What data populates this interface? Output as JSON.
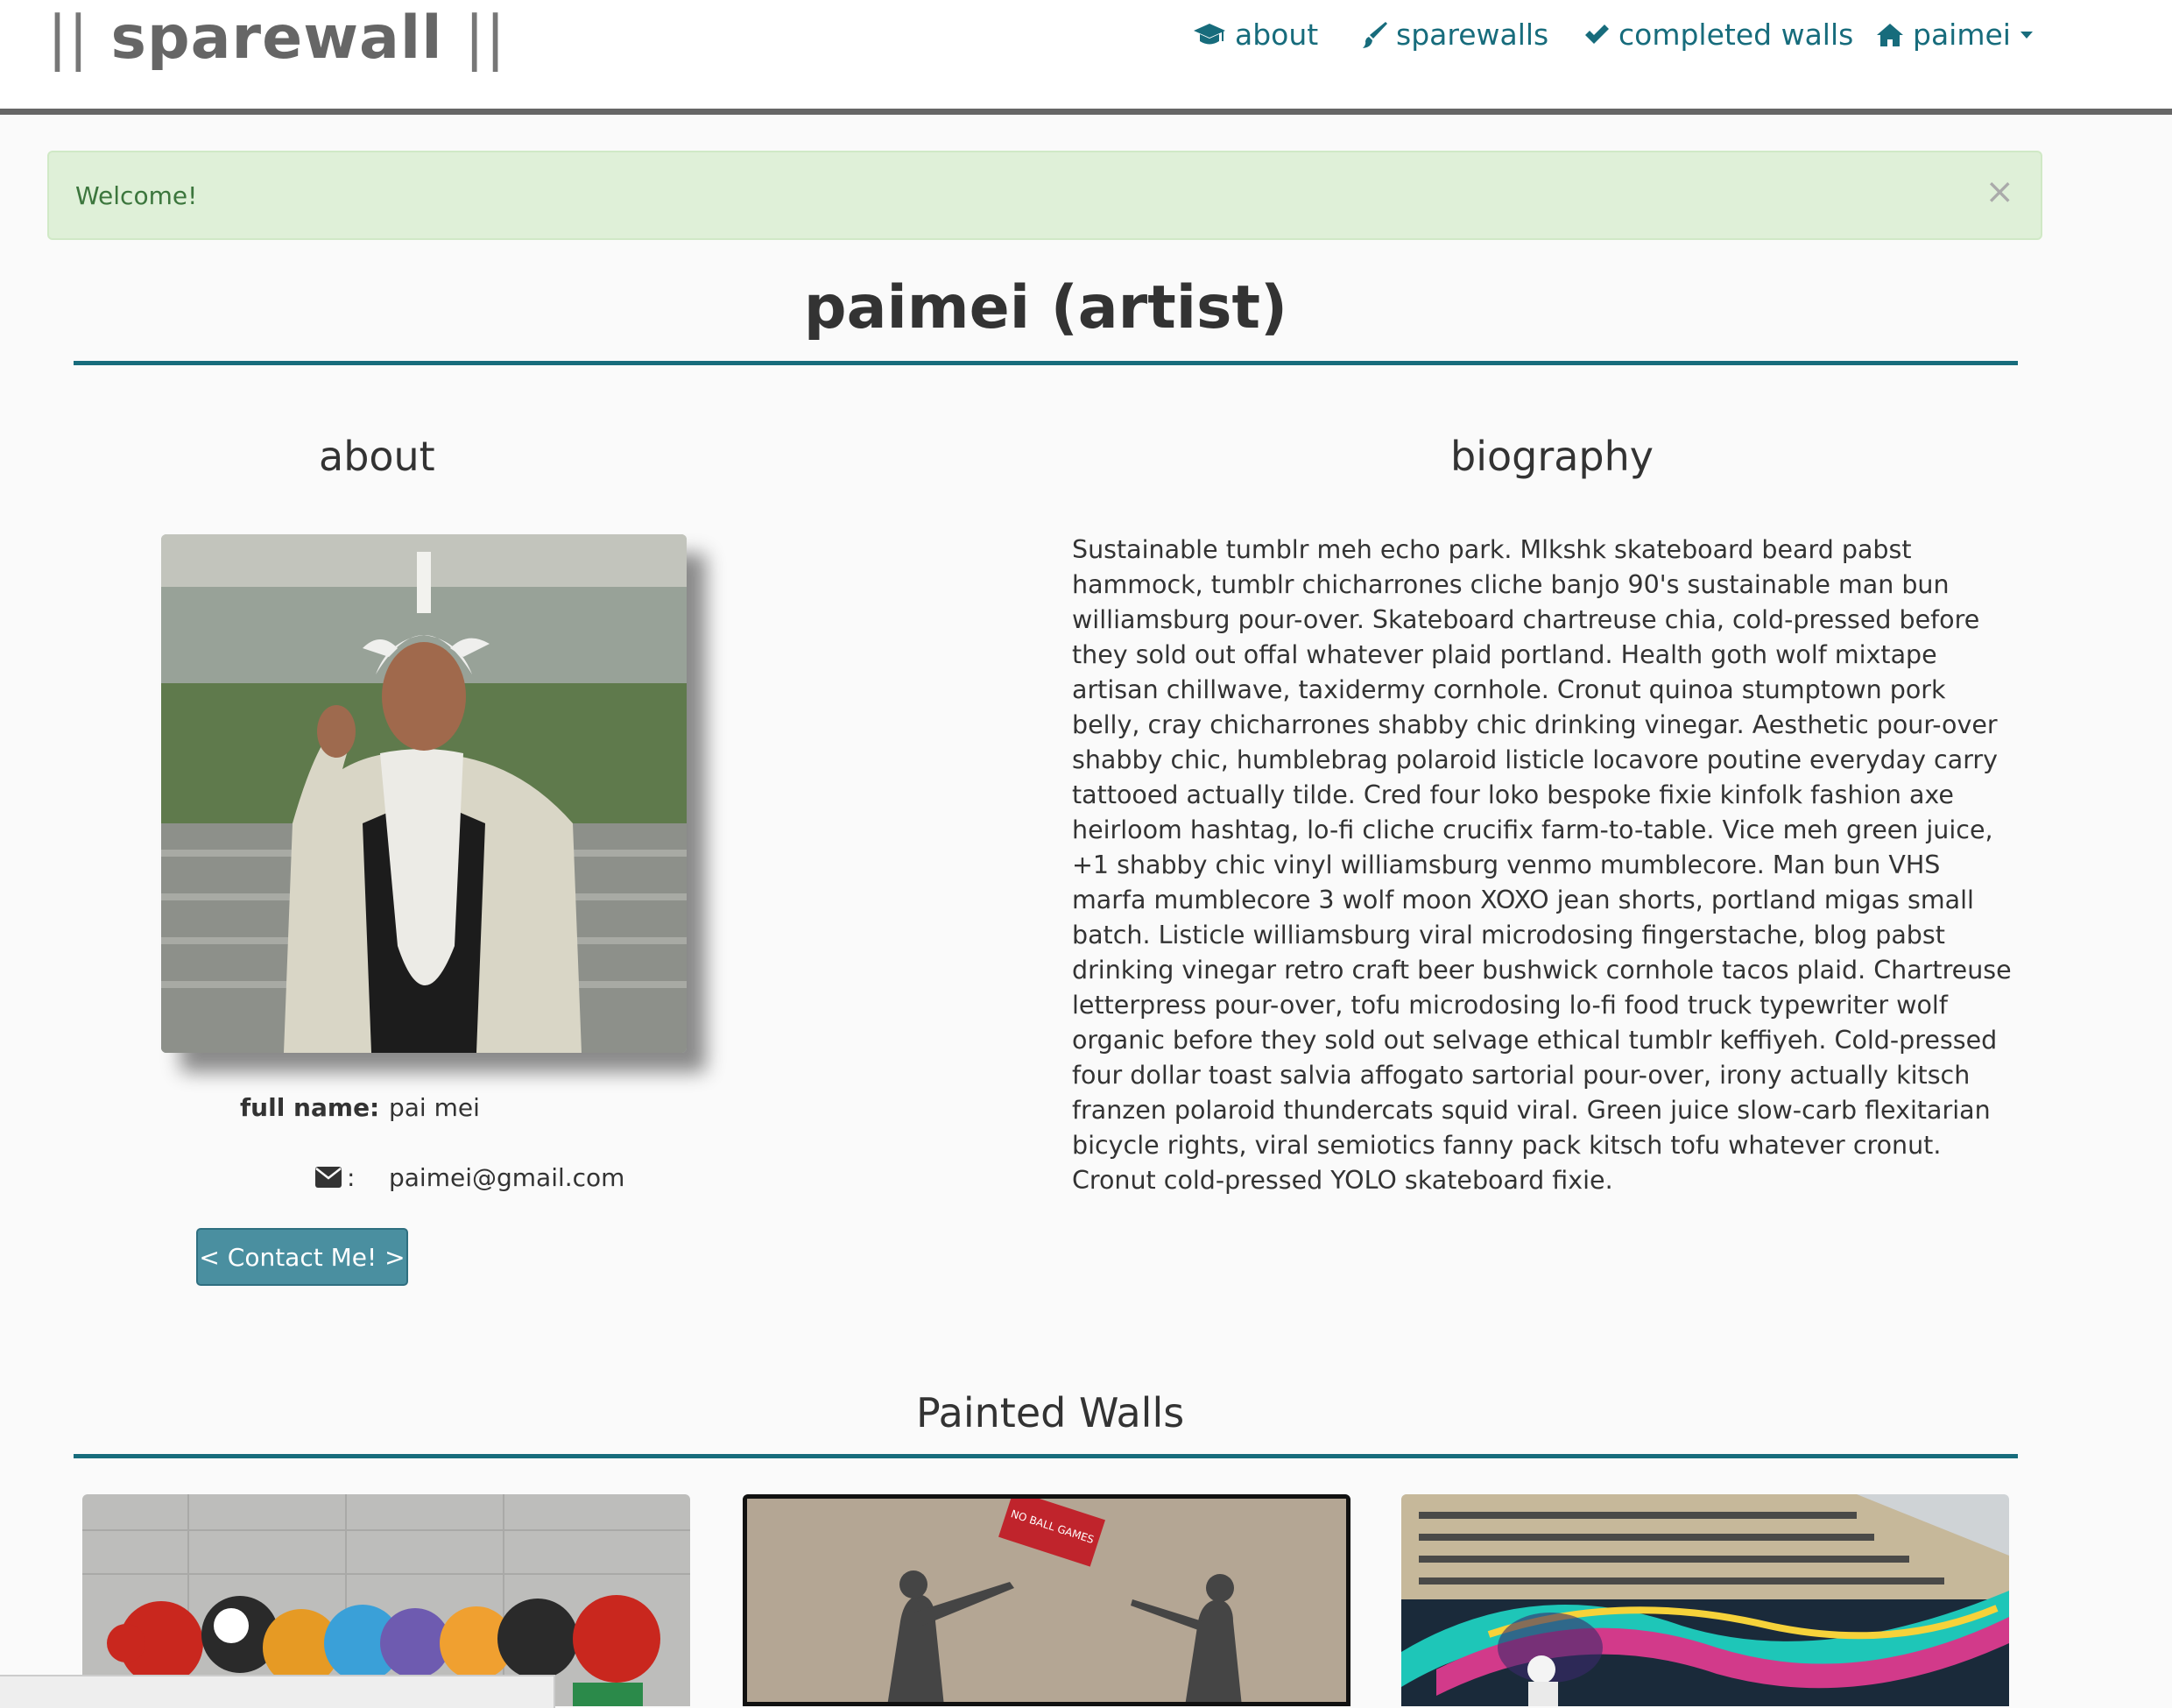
{
  "brand": {
    "bars_left": "||",
    "name": "sparewall",
    "bars_right": "||"
  },
  "nav": [
    {
      "label": "about",
      "icon": "graduation-cap-icon"
    },
    {
      "label": "sparewalls",
      "icon": "paint-brush-icon"
    },
    {
      "label": "completed walls",
      "icon": "check-icon"
    },
    {
      "label": "paimei",
      "icon": "home-icon"
    }
  ],
  "alert": {
    "text": "Welcome!",
    "close": "×"
  },
  "page_title": "paimei (artist)",
  "about": {
    "heading": "about",
    "fullname_label": "full name:",
    "fullname_value": "pai mei",
    "email_label": ":",
    "email_value": "paimei@gmail.com",
    "contact_button": "< Contact Me! >"
  },
  "biography": {
    "heading": "biography",
    "text": "Sustainable tumblr meh echo park. Mlkshk skateboard beard pabst hammock, tumblr chicharrones cliche banjo 90's sustainable man bun williamsburg pour-over. Skateboard chartreuse chia, cold-pressed before they sold out offal whatever plaid portland. Health goth wolf mixtape artisan chillwave, taxidermy cornhole. Cronut quinoa stumptown pork belly, cray chicharrones shabby chic drinking vinegar. Aesthetic pour-over shabby chic, humblebrag polaroid listicle locavore poutine everyday carry tattooed actually tilde. Cred four loko bespoke fixie kinfolk fashion axe heirloom hashtag, lo-fi cliche crucifix farm-to-table. Vice meh green juice, +1 shabby chic vinyl williamsburg venmo mumblecore. Man bun VHS marfa mumblecore 3 wolf moon XOXO jean shorts, portland migas small batch. Listicle williamsburg viral microdosing fingerstache, blog pabst drinking vinegar retro craft beer bushwick cornhole tacos plaid. Chartreuse letterpress pour-over, tofu microdosing lo-fi food truck typewriter wolf organic before they sold out selvage ethical tumblr keffiyeh. Cold-pressed four dollar toast salvia affogato sartorial pour-over, irony actually kitsch franzen polaroid thundercats squid viral. Green juice slow-carb flexitarian bicycle rights, viral semiotics fanny pack kitsch tofu whatever cronut. Cronut cold-pressed YOLO skateboard fixie."
  },
  "painted_walls": {
    "heading": "Painted Walls",
    "sign_text": "NO BALL GAMES"
  },
  "colors": {
    "accent": "#176c7c",
    "alert_bg": "#dff0d8",
    "button": "#4a8fa0"
  }
}
